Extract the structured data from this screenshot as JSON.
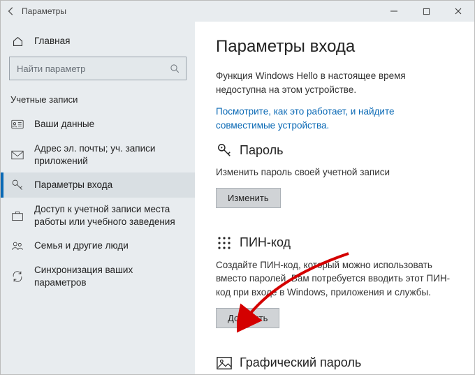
{
  "window": {
    "title": "Параметры"
  },
  "sidebar": {
    "home": "Главная",
    "search_placeholder": "Найти параметр",
    "category": "Учетные записи",
    "items": [
      {
        "label": "Ваши данные"
      },
      {
        "label": "Адрес эл. почты; уч. записи приложений"
      },
      {
        "label": "Параметры входа"
      },
      {
        "label": "Доступ к учетной записи места работы или учебного заведения"
      },
      {
        "label": "Семья и другие люди"
      },
      {
        "label": "Синхронизация ваших параметров"
      }
    ]
  },
  "content": {
    "heading": "Параметры входа",
    "hello_text": "Функция Windows Hello в настоящее время недоступна на этом устройстве.",
    "hello_link": "Посмотрите, как это работает, и найдите совместимые устройства.",
    "password": {
      "title": "Пароль",
      "desc": "Изменить пароль своей учетной записи",
      "button": "Изменить"
    },
    "pin": {
      "title": "ПИН-код",
      "desc": "Создайте ПИН-код, который можно использовать вместо паролей. Вам потребуется вводить этот ПИН-код при входе в Windows, приложения и службы.",
      "button": "Добавить"
    },
    "picture": {
      "title": "Графический пароль"
    }
  }
}
